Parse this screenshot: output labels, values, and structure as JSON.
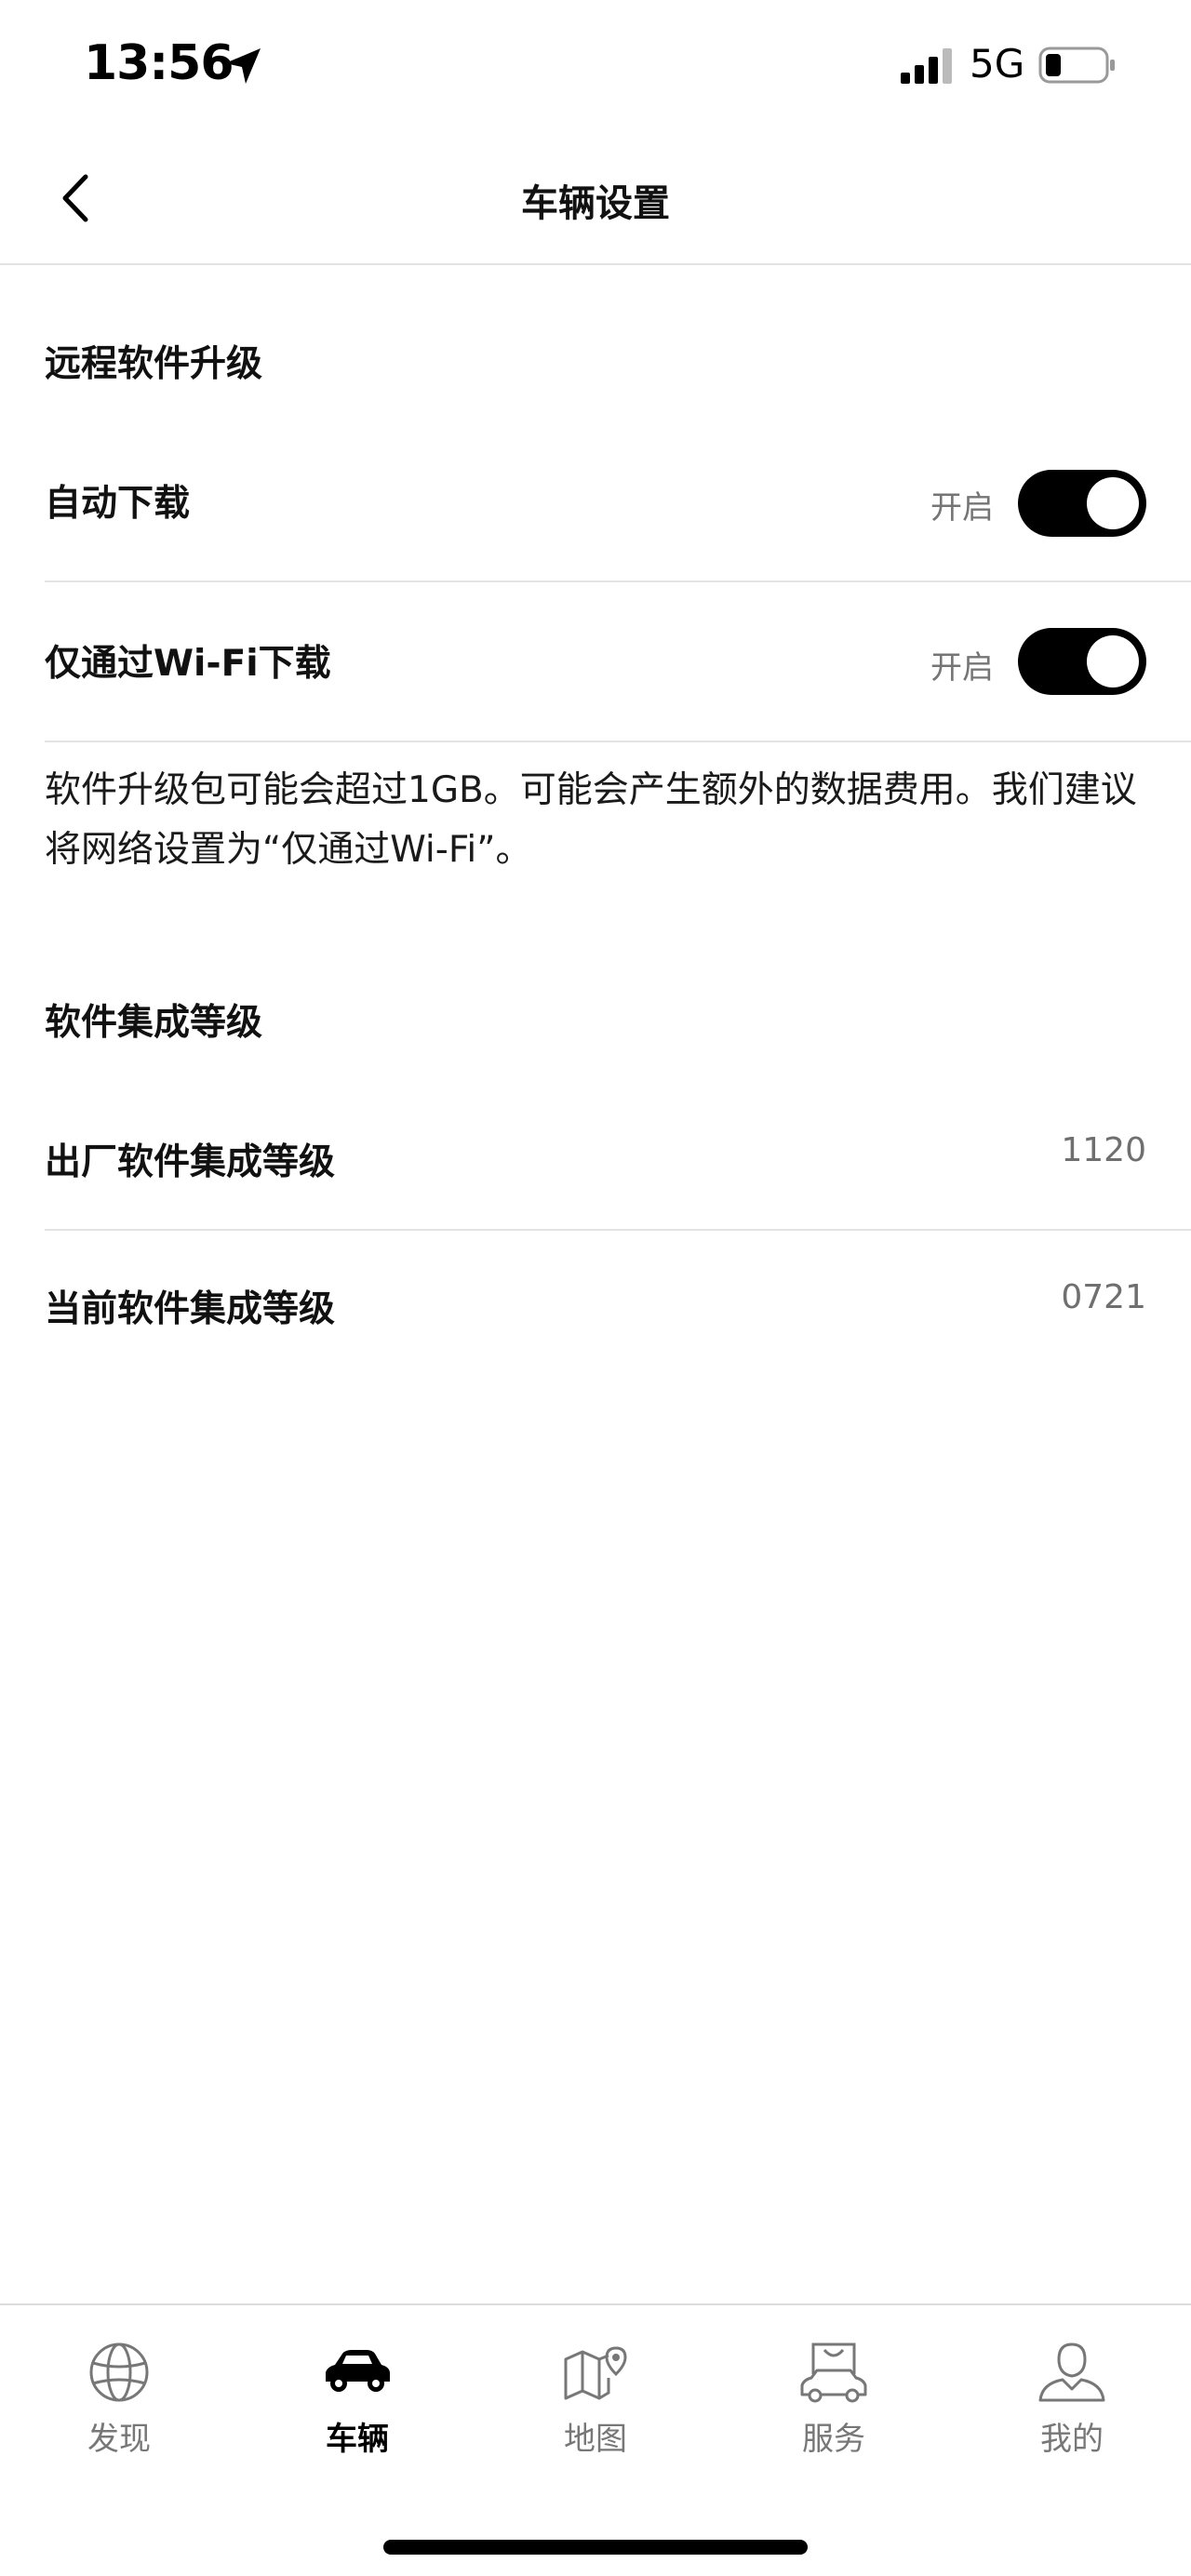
{
  "status_bar": {
    "time": "13:56",
    "network": "5G"
  },
  "header": {
    "title": "车辆设置"
  },
  "ota": {
    "section_title": "远程软件升级",
    "auto_download": {
      "label": "自动下载",
      "status": "开启",
      "on": true
    },
    "wifi_only": {
      "label": "仅通过Wi-Fi下载",
      "status": "开启",
      "on": true
    },
    "info": "软件升级包可能会超过1GB。可能会产生额外的数据费用。我们建议将网络设置为“仅通过Wi-Fi”。"
  },
  "integration": {
    "section_title": "软件集成等级",
    "factory": {
      "label": "出厂软件集成等级",
      "value": "1120"
    },
    "current": {
      "label": "当前软件集成等级",
      "value": "0721"
    }
  },
  "tab_bar": {
    "tabs": [
      {
        "label": "发现",
        "icon": "globe-icon",
        "active": false
      },
      {
        "label": "车辆",
        "icon": "car-icon",
        "active": true
      },
      {
        "label": "地图",
        "icon": "map-icon",
        "active": false
      },
      {
        "label": "服务",
        "icon": "shopping-car-icon",
        "active": false
      },
      {
        "label": "我的",
        "icon": "user-icon",
        "active": false
      }
    ]
  }
}
